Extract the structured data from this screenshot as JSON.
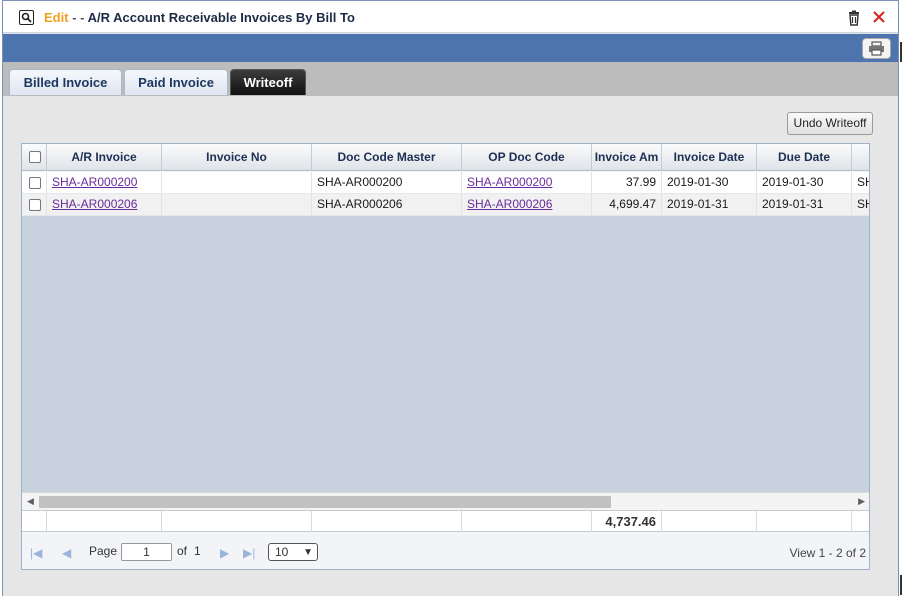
{
  "title": {
    "edit": "Edit",
    "separator": "- -",
    "main": "A/R Account Receivable Invoices By Bill To"
  },
  "tabs": [
    {
      "label": "Billed Invoice",
      "active": false
    },
    {
      "label": "Paid Invoice",
      "active": false
    },
    {
      "label": "Writeoff",
      "active": true
    }
  ],
  "toolbar": {
    "undo_writeoff_label": "Undo Writeoff"
  },
  "grid": {
    "columns": [
      "A/R Invoice",
      "Invoice No",
      "Doc Code Master",
      "OP Doc Code",
      "Invoice Am",
      "Invoice Date",
      "Due Date",
      ""
    ],
    "rows": [
      {
        "ar_invoice": "SHA-AR000200",
        "invoice_no": "",
        "doc_code_master": "SHA-AR000200",
        "op_doc_code": "SHA-AR000200",
        "invoice_amount": "37.99",
        "invoice_date": "2019-01-30",
        "due_date": "2019-01-30",
        "extra": "SH"
      },
      {
        "ar_invoice": "SHA-AR000206",
        "invoice_no": "",
        "doc_code_master": "SHA-AR000206",
        "op_doc_code": "SHA-AR000206",
        "invoice_amount": "4,699.47",
        "invoice_date": "2019-01-31",
        "due_date": "2019-01-31",
        "extra": "SH"
      }
    ],
    "footer_total": "4,737.46"
  },
  "pager": {
    "page_label": "Page",
    "page_value": "1",
    "of_label": "of",
    "total_pages": "1",
    "rows_per_page": "10",
    "view_label": "View 1 - 2 of 2"
  },
  "colors": {
    "title_edit": "#f0a020",
    "header_bar": "#4d74ad",
    "active_tab": "#111111",
    "link": "#6a2c9c",
    "grid_empty": "#c8d2de"
  },
  "icons": [
    "preview-icon",
    "trash-icon",
    "close-icon",
    "print-icon",
    "first-page-icon",
    "prev-page-icon",
    "next-page-icon",
    "last-page-icon",
    "scroll-left-icon",
    "scroll-right-icon"
  ]
}
